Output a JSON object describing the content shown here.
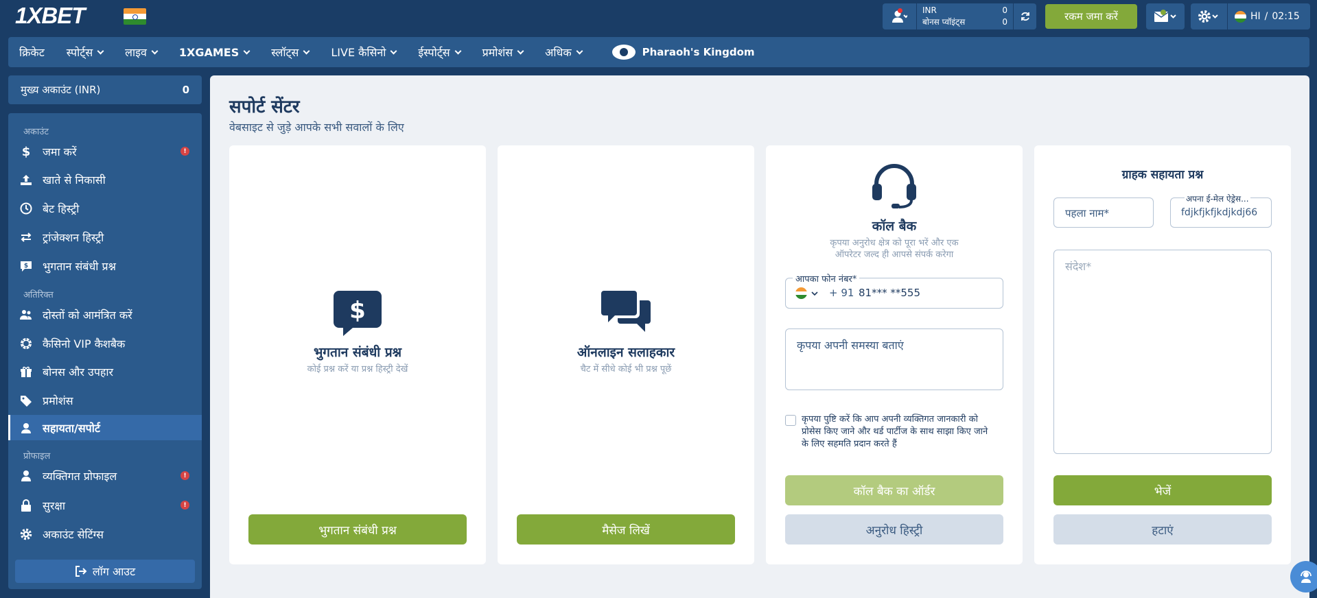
{
  "header": {
    "logo": "1XBET",
    "account": {
      "currency": "INR",
      "currency_value": "0",
      "bonus_label": "बोनस प्वॉइंट्स",
      "bonus_value": "0"
    },
    "deposit_button": "रकम जमा करें",
    "mail_badge": "1",
    "language": "HI",
    "separator": "/",
    "time": "02:15"
  },
  "nav": {
    "items": [
      {
        "label": "क्रिकेट",
        "dropdown": false,
        "bold": false
      },
      {
        "label": "स्पोर्ट्स",
        "dropdown": true,
        "bold": false
      },
      {
        "label": "लाइव",
        "dropdown": true,
        "bold": false
      },
      {
        "label": "1XGAMES",
        "dropdown": true,
        "bold": true
      },
      {
        "label": "स्लॉट्स",
        "dropdown": true,
        "bold": false
      },
      {
        "label": "LIVE कैसिनो",
        "dropdown": true,
        "bold": false
      },
      {
        "label": "ईस्पोर्ट्स",
        "dropdown": true,
        "bold": false
      },
      {
        "label": "प्रमोशंस",
        "dropdown": true,
        "bold": false
      },
      {
        "label": "अधिक",
        "dropdown": true,
        "bold": false
      }
    ],
    "promo": "Pharaoh's Kingdom"
  },
  "sidebar": {
    "main_account": {
      "label": "मुख्य अकाउंट (INR)",
      "value": "0"
    },
    "sections": {
      "account": "अकाउंट",
      "extra": "अतिरिक्त",
      "profile": "प्रोफाइल"
    },
    "items": {
      "deposit": "जमा करें",
      "withdraw": "खाते से निकासी",
      "bet_history": "बेट हिस्ट्री",
      "transaction_history": "ट्रांजेक्शन हिस्ट्री",
      "payment_questions": "भुगतान संबंधी प्रश्न",
      "invite_friends": "दोस्तों को आमंत्रित करें",
      "casino_cashback": "कैसिनो VIP कैशबैक",
      "bonuses": "बोनस और उपहार",
      "promotions": "प्रमोशंस",
      "support": "सहायता/सपोर्ट",
      "personal_profile": "व्यक्तिगत प्रोफाइल",
      "security": "सुरक्षा",
      "account_settings": "अकाउंट सेटिंग्स"
    },
    "alert_mark": "!",
    "logout": "लॉग आउट"
  },
  "page": {
    "title": "सपोर्ट सेंटर",
    "subtitle": "वेबसाइट से जुड़े आपके सभी सवालों के लिए"
  },
  "cards": {
    "payment": {
      "title": "भुगतान संबंधी प्रश्न",
      "subtitle": "कोई प्रश्न करें या प्रश्न हिस्ट्री देखें",
      "button": "भुगतान संबंधी प्रश्न"
    },
    "online": {
      "title": "ऑनलाइन सलाहकार",
      "subtitle": "चैट में सीधे कोई भी प्रश्न पूछें",
      "button": "मैसेज लिखें"
    },
    "callback": {
      "title": "कॉल बैक",
      "subtitle_line1": "कृपया अनुरोध क्षेत्र को पूरा भरें और एक",
      "subtitle_line2": "ऑपरेटर जल्द ही आपसे संपर्क करेगा",
      "phone_label": "आपका फोन नंबर*",
      "phone_code": "+ 91",
      "phone_value": "81*** **555",
      "problem_placeholder": "कृपया अपनी समस्या बताएं",
      "consent_line1": "कृपया पुष्टि करें कि आप अपनी व्यक्तिगत जानकारी को",
      "consent_line2": "प्रोसेस किए जाने और थर्ड पार्टीज के साथ साझा किए जाने",
      "consent_line3": "के लिए सहमति प्रदान करते हैं",
      "order_button": "कॉल बैक का ऑर्डर",
      "history_button": "अनुरोध हिस्ट्री"
    },
    "customer": {
      "title": "ग्राहक सहायता प्रश्न",
      "first_name_placeholder": "पहला नाम*",
      "email_label": "अपना ई-मेल ऐड्रेस...",
      "email_value": "fdjkfjkfjkdjkdj66",
      "message_placeholder": "संदेश*",
      "send_button": "भेजें",
      "clear_button": "हटाएं"
    }
  },
  "colors": {
    "background": "#1a3d66",
    "panel": "#2b5a8c",
    "accent_green": "#83a93a",
    "text_dark": "#1e3a5f",
    "alert_red": "#d64444"
  }
}
